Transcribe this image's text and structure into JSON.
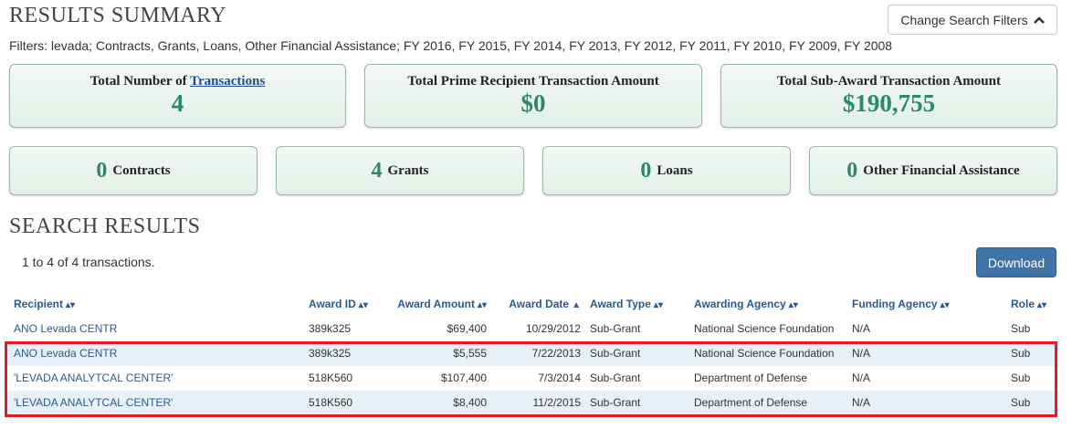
{
  "summary": {
    "heading": "RESULTS SUMMARY",
    "filters": "Filters: levada; Contracts, Grants, Loans, Other Financial Assistance; FY 2016, FY 2015, FY 2014, FY 2013, FY 2012, FY 2011, FY 2010, FY 2009, FY 2008",
    "change_filters_label": "Change Search Filters",
    "total_transactions_prefix": "Total Number of",
    "total_transactions_link": "Transactions",
    "total_transactions_value": "4",
    "prime_amount_title": "Total Prime Recipient Transaction Amount",
    "prime_amount_value": "$0",
    "subaward_title": "Total Sub-Award Transaction Amount",
    "subaward_value": "$190,755",
    "categories": [
      {
        "count": "0",
        "label": "Contracts"
      },
      {
        "count": "4",
        "label": "Grants"
      },
      {
        "count": "0",
        "label": "Loans"
      },
      {
        "count": "0",
        "label": "Other Financial Assistance"
      }
    ]
  },
  "results": {
    "heading": "SEARCH RESULTS",
    "count_text": "1 to 4 of 4 transactions.",
    "download_label": "Download",
    "columns": [
      "Recipient",
      "Award ID",
      "Award Amount",
      "Award Date",
      "Award Type",
      "Awarding Agency",
      "Funding Agency",
      "Role"
    ],
    "rows": [
      [
        "ANO Levada CENTR",
        "389k325",
        "$69,400",
        "10/29/2012",
        "Sub-Grant",
        "National Science Foundation",
        "N/A",
        "Sub"
      ],
      [
        "ANO Levada CENTR",
        "389k325",
        "$5,555",
        "7/22/2013",
        "Sub-Grant",
        "National Science Foundation",
        "N/A",
        "Sub"
      ],
      [
        "'LEVADA ANALYTCAL CENTER'",
        "518K560",
        "$107,400",
        "7/3/2014",
        "Sub-Grant",
        "Department of Defense",
        "N/A",
        "Sub"
      ],
      [
        "'LEVADA ANALYTCAL CENTER'",
        "518K560",
        "$8,400",
        "11/2/2015",
        "Sub-Grant",
        "Department of Defense",
        "N/A",
        "Sub"
      ]
    ]
  },
  "colors": {
    "accent_green": "#2a8a6b",
    "link_blue": "#2b5a8c",
    "highlight_red": "#e31b23",
    "download_blue": "#3f74a8"
  }
}
